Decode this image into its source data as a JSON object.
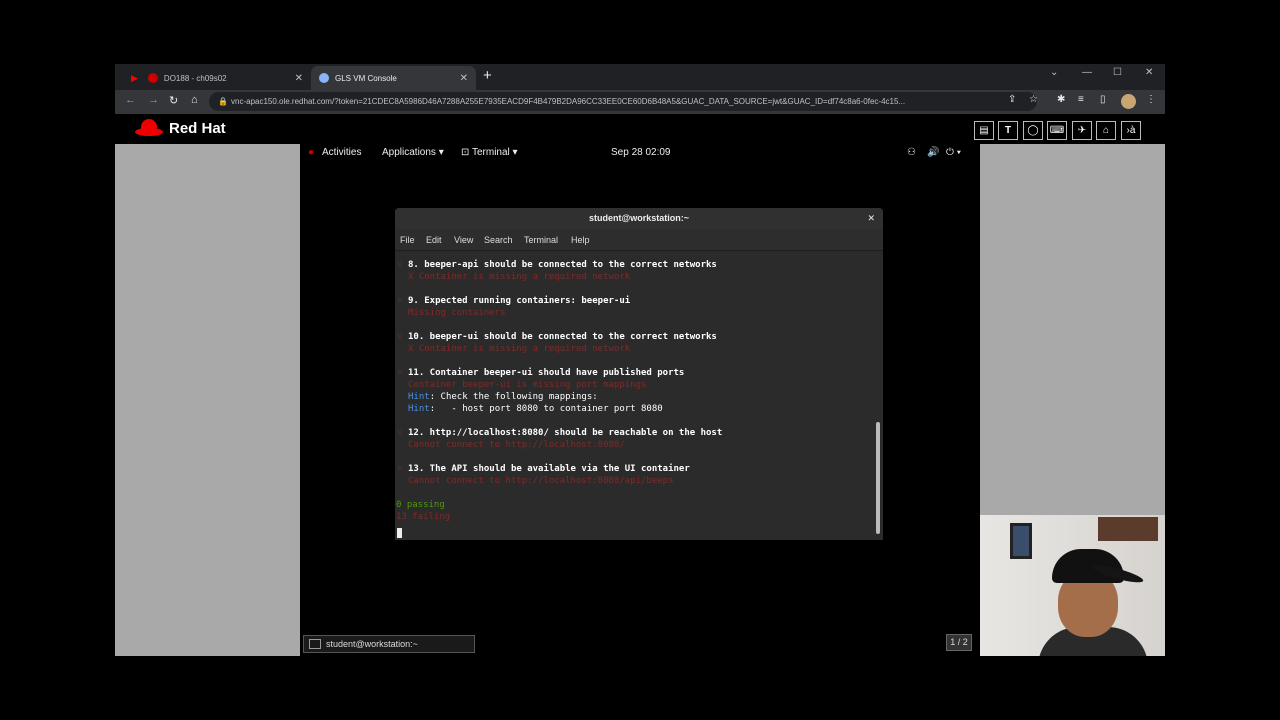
{
  "browser": {
    "tabs": [
      {
        "label": "DO188 - ch09s02",
        "favicon_color": "#cc0000",
        "active": false
      },
      {
        "label": "GLS VM Console",
        "favicon_color": "#8ab4f8",
        "active": true
      }
    ],
    "url": "vnc-apac150.ole.redhat.com/?token=21CDEC8A5986D46A7288A255E7935EACD9F4B479B2DA96CC33EE0CE60D6B48A5&GUAC_DATA_SOURCE=jwt&GUAC_ID=df74c8a6-0fec-4c15..."
  },
  "redhat": {
    "brand": "Red Hat",
    "toolbar_icons": [
      "document-icon",
      "text-icon",
      "refresh-icon",
      "keyboard-icon",
      "pin-icon",
      "lock-icon",
      "console-icon"
    ]
  },
  "gnome": {
    "activities": "Activities",
    "applications": "Applications",
    "terminal_menu": "Terminal",
    "clock": "Sep 28  02:09"
  },
  "terminal": {
    "title": "student@workstation:~",
    "menu": [
      "File",
      "Edit",
      "View",
      "Search",
      "Terminal",
      "Help"
    ],
    "lines": [
      {
        "text": "8. beeper-api should be connected to the correct networks",
        "style": "bold",
        "mark": "x"
      },
      {
        "text": "X Container is missing a required network",
        "style": "err"
      },
      {
        "text": "9. Expected running containers: beeper-ui",
        "style": "bold",
        "mark": "x"
      },
      {
        "text": "Missing containers",
        "style": "err"
      },
      {
        "text": "10. beeper-ui should be connected to the correct networks",
        "style": "bold",
        "mark": "x"
      },
      {
        "text": "X Container is missing a required network",
        "style": "err"
      },
      {
        "text": "11. Container beeper-ui should have published ports",
        "style": "bold",
        "mark": "x"
      },
      {
        "text": "Container beeper-ui is missing port mappings",
        "style": "err"
      },
      {
        "hint": "Hint",
        "text": ": Check the following mappings:"
      },
      {
        "hint": "Hint",
        "text": ":   - host port 8080 to container port 8080"
      },
      {
        "text": "12. http://localhost:8080/ should be reachable on the host",
        "style": "bold",
        "mark": "x"
      },
      {
        "text": "Cannot connect to http://localhost:8080/",
        "style": "err"
      },
      {
        "text": "13. The API should be available via the UI container",
        "style": "bold",
        "mark": "x"
      },
      {
        "text": "Cannot connect to http://localhost:8080/api/beeps",
        "style": "err"
      },
      {
        "text": "0 passing",
        "style": "pass"
      },
      {
        "text": "13 failing",
        "style": "failing"
      }
    ]
  },
  "taskbar": {
    "item": "student@workstation:~",
    "workspace": "1 / 2"
  }
}
